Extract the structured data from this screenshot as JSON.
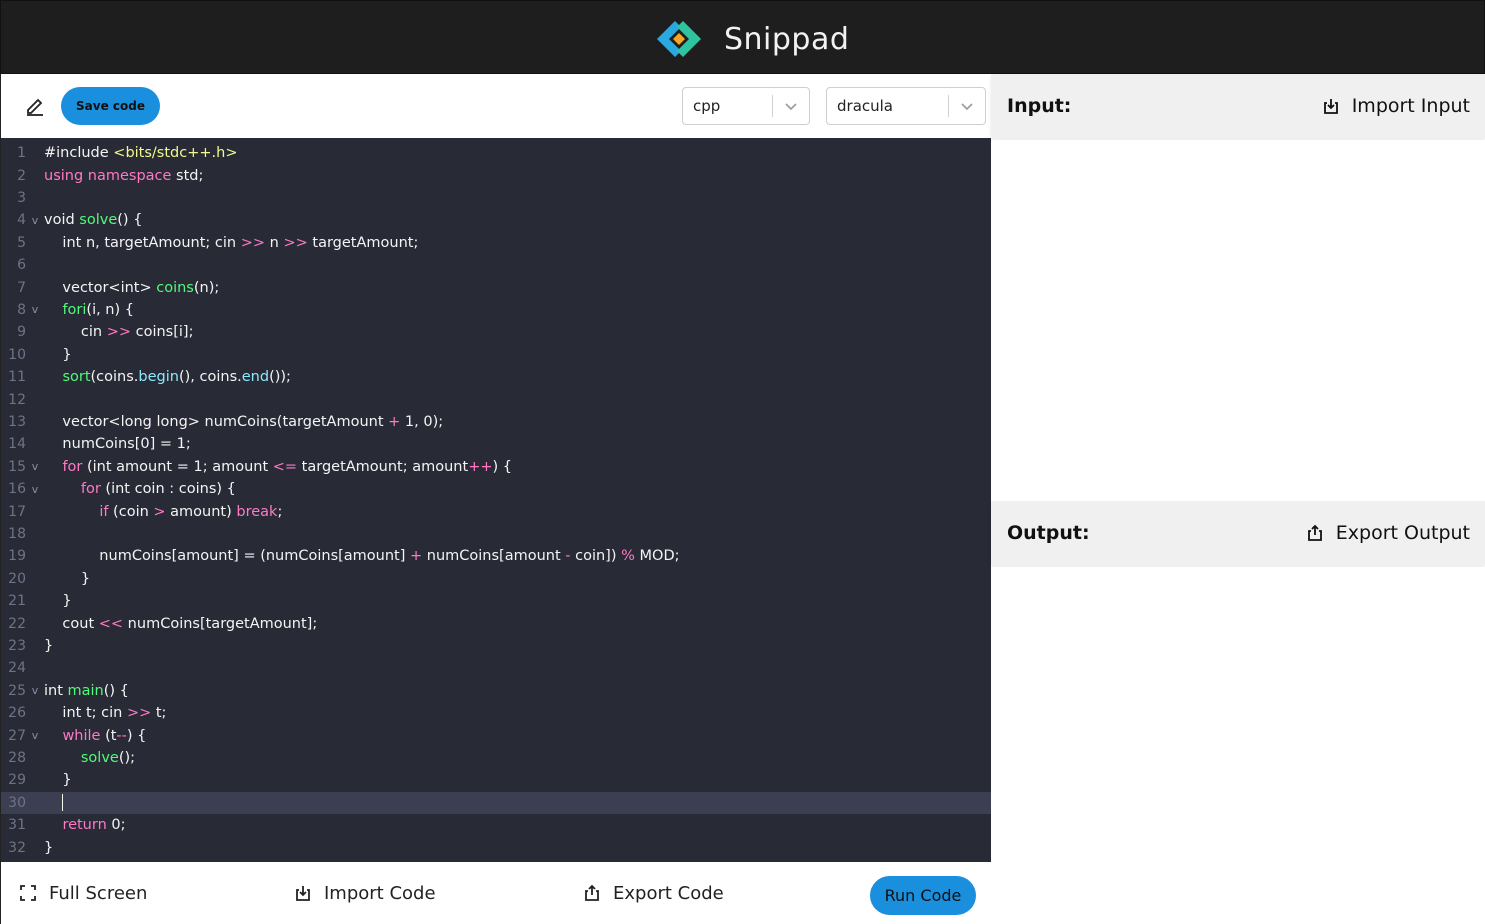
{
  "app": {
    "name": "Snippad"
  },
  "toolbar": {
    "save_label": "Save code",
    "language": "cpp",
    "theme": "dracula"
  },
  "editor": {
    "active_line": 30,
    "lines": [
      {
        "n": "1",
        "fold": "",
        "tokens": [
          [
            "",
            "#include "
          ],
          [
            "str",
            "<bits/stdc++.h>"
          ]
        ]
      },
      {
        "n": "2",
        "fold": "",
        "tokens": [
          [
            "kw",
            "using namespace"
          ],
          [
            "",
            " std;"
          ]
        ]
      },
      {
        "n": "3",
        "fold": "",
        "tokens": []
      },
      {
        "n": "4",
        "fold": "v",
        "tokens": [
          [
            "",
            "void "
          ],
          [
            "fn",
            "solve"
          ],
          [
            "",
            "() {"
          ]
        ]
      },
      {
        "n": "5",
        "fold": "",
        "tokens": [
          [
            "",
            "    int n, targetAmount; cin "
          ],
          [
            "op",
            ">>"
          ],
          [
            "",
            " n "
          ],
          [
            "op",
            ">>"
          ],
          [
            "",
            " targetAmount;"
          ]
        ]
      },
      {
        "n": "6",
        "fold": "",
        "tokens": []
      },
      {
        "n": "7",
        "fold": "",
        "tokens": [
          [
            "",
            "    vector<int> "
          ],
          [
            "fn",
            "coins"
          ],
          [
            "",
            "(n);"
          ]
        ]
      },
      {
        "n": "8",
        "fold": "v",
        "tokens": [
          [
            "",
            "    "
          ],
          [
            "fn",
            "fori"
          ],
          [
            "",
            "(i, n) {"
          ]
        ]
      },
      {
        "n": "9",
        "fold": "",
        "tokens": [
          [
            "",
            "        cin "
          ],
          [
            "op",
            ">>"
          ],
          [
            "",
            " coins[i];"
          ]
        ]
      },
      {
        "n": "10",
        "fold": "",
        "tokens": [
          [
            "",
            "    }"
          ]
        ]
      },
      {
        "n": "11",
        "fold": "",
        "tokens": [
          [
            "",
            "    "
          ],
          [
            "fn",
            "sort"
          ],
          [
            "",
            "(coins."
          ],
          [
            "mem",
            "begin"
          ],
          [
            "",
            "(), coins."
          ],
          [
            "mem",
            "end"
          ],
          [
            "",
            "());"
          ]
        ]
      },
      {
        "n": "12",
        "fold": "",
        "tokens": []
      },
      {
        "n": "13",
        "fold": "",
        "tokens": [
          [
            "",
            "    vector<long long> numCoins(targetAmount "
          ],
          [
            "op",
            "+"
          ],
          [
            "",
            " 1, 0);"
          ]
        ]
      },
      {
        "n": "14",
        "fold": "",
        "tokens": [
          [
            "",
            "    numCoins[0] = 1;"
          ]
        ]
      },
      {
        "n": "15",
        "fold": "v",
        "tokens": [
          [
            "",
            "    "
          ],
          [
            "kw",
            "for"
          ],
          [
            "",
            " (int amount = 1; amount "
          ],
          [
            "op",
            "<="
          ],
          [
            "",
            " targetAmount; amount"
          ],
          [
            "op",
            "++"
          ],
          [
            "",
            ") {"
          ]
        ]
      },
      {
        "n": "16",
        "fold": "v",
        "tokens": [
          [
            "",
            "        "
          ],
          [
            "kw",
            "for"
          ],
          [
            "",
            " (int coin : coins) {"
          ]
        ]
      },
      {
        "n": "17",
        "fold": "",
        "tokens": [
          [
            "",
            "            "
          ],
          [
            "kw",
            "if"
          ],
          [
            "",
            " (coin "
          ],
          [
            "op",
            ">"
          ],
          [
            "",
            " amount) "
          ],
          [
            "kw",
            "break"
          ],
          [
            "",
            ";"
          ]
        ]
      },
      {
        "n": "18",
        "fold": "",
        "tokens": []
      },
      {
        "n": "19",
        "fold": "",
        "tokens": [
          [
            "",
            "            numCoins[amount] = (numCoins[amount] "
          ],
          [
            "op",
            "+"
          ],
          [
            "",
            " numCoins[amount "
          ],
          [
            "op",
            "-"
          ],
          [
            "",
            " coin]) "
          ],
          [
            "op",
            "%"
          ],
          [
            "",
            " MOD;"
          ]
        ]
      },
      {
        "n": "20",
        "fold": "",
        "tokens": [
          [
            "",
            "        }"
          ]
        ]
      },
      {
        "n": "21",
        "fold": "",
        "tokens": [
          [
            "",
            "    }"
          ]
        ]
      },
      {
        "n": "22",
        "fold": "",
        "tokens": [
          [
            "",
            "    cout "
          ],
          [
            "op",
            "<<"
          ],
          [
            "",
            " numCoins[targetAmount];"
          ]
        ]
      },
      {
        "n": "23",
        "fold": "",
        "tokens": [
          [
            "",
            "}"
          ]
        ]
      },
      {
        "n": "24",
        "fold": "",
        "tokens": []
      },
      {
        "n": "25",
        "fold": "v",
        "tokens": [
          [
            "",
            "int "
          ],
          [
            "fn",
            "main"
          ],
          [
            "",
            "() {"
          ]
        ]
      },
      {
        "n": "26",
        "fold": "",
        "tokens": [
          [
            "",
            "    int t; cin "
          ],
          [
            "op",
            ">>"
          ],
          [
            "",
            " t;"
          ]
        ]
      },
      {
        "n": "27",
        "fold": "v",
        "tokens": [
          [
            "",
            "    "
          ],
          [
            "kw",
            "while"
          ],
          [
            "",
            " (t"
          ],
          [
            "op",
            "--"
          ],
          [
            "",
            ") {"
          ]
        ]
      },
      {
        "n": "28",
        "fold": "",
        "tokens": [
          [
            "",
            "        "
          ],
          [
            "fn",
            "solve"
          ],
          [
            "",
            "();"
          ]
        ]
      },
      {
        "n": "29",
        "fold": "",
        "tokens": [
          [
            "",
            "    }"
          ]
        ]
      },
      {
        "n": "30",
        "fold": "",
        "tokens": [
          [
            "",
            "    "
          ]
        ]
      },
      {
        "n": "31",
        "fold": "",
        "tokens": [
          [
            "",
            "    "
          ],
          [
            "kw",
            "return"
          ],
          [
            "",
            " 0;"
          ]
        ]
      },
      {
        "n": "32",
        "fold": "",
        "tokens": [
          [
            "",
            "}"
          ]
        ]
      }
    ]
  },
  "bottom": {
    "fullscreen_label": "Full Screen",
    "import_code_label": "Import Code",
    "export_code_label": "Export Code",
    "run_label": "Run Code"
  },
  "input_panel": {
    "title": "Input:",
    "action_label": "Import Input"
  },
  "output_panel": {
    "title": "Output:",
    "action_label": "Export Output"
  },
  "colors": {
    "accent": "#1a8fdd",
    "editor_bg": "#282a36",
    "header_bg": "#1e1e1e",
    "keyword": "#ff79c6",
    "function": "#50fa7b",
    "string": "#f1fa8c",
    "member": "#8be9fd"
  },
  "icons": {
    "logo": "diamond-logo-icon",
    "edit": "pencil-icon",
    "dropdown": "chevron-down-icon",
    "fullscreen": "fullscreen-icon",
    "import": "import-icon",
    "export": "export-icon"
  }
}
